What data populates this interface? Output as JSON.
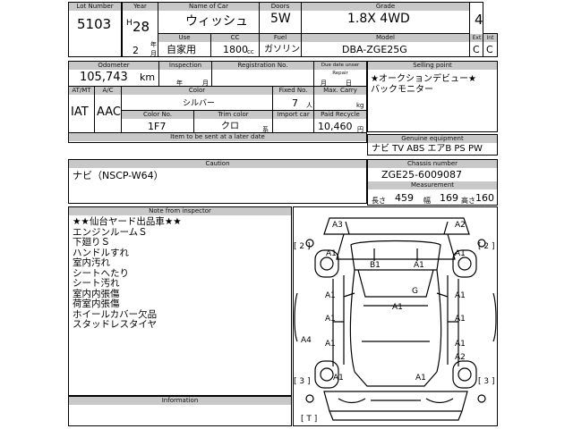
{
  "header": {
    "lot_number_label": "Lot Number",
    "lot_number": "5103",
    "year_label": "Year",
    "era": "H",
    "year": "28",
    "year_unit": "年",
    "month": "2",
    "month_unit": "月",
    "name_label": "Name of Car",
    "name": "ウィッシュ",
    "doors_label": "Doors",
    "doors": "5W",
    "grade_label": "Grade",
    "grade": "1.8X 4WD",
    "score": "4",
    "use_label": "Use",
    "use": "自家用",
    "cc_label": "CC",
    "cc": "1800",
    "cc_unit": "cc",
    "fuel_label": "Fuel",
    "fuel": "ガソリン",
    "model_label": "Model",
    "model": "DBA-ZGE25G",
    "ext_label": "Ext",
    "ext": "C",
    "int_label": "Int",
    "int": "C"
  },
  "row2": {
    "odometer_label": "Odometer",
    "odometer": "105,743",
    "odometer_unit": "km",
    "inspection_label": "Inspection",
    "inspection_year": "年",
    "inspection_month": "月",
    "registration_label": "Registration No.",
    "due_label": "Due date unser Repair",
    "due_month": "月",
    "due_day": "日",
    "selling_label": "Selling point",
    "selling_points": [
      "★オークションデビュー★",
      "バックモニター"
    ],
    "atmt_label": "AT/MT",
    "atmt": "IAT",
    "ac_label": "A/C",
    "ac": "AAC",
    "color_label": "Color",
    "color": "シルバー",
    "fixed_label": "Fixed No.",
    "fixed": "7",
    "fixed_unit": "人",
    "maxcarry_label": "Max. Carry",
    "maxcarry_unit": "kg",
    "colorno_label": "Color No.",
    "colorno": "1F7",
    "trim_label": "Trim color",
    "trim": "クロ",
    "trim_unit": "系",
    "import_label": "Import car",
    "recycle_label": "Paid Recycle",
    "recycle": "10,460",
    "recycle_unit": "円",
    "later_label": "Item to be sent at a later date",
    "equip_label": "Genuine equipment",
    "equipment": "ナビ TV ABS エアB PS PW"
  },
  "caution": {
    "label": "Caution",
    "text": "ナビ（NSCP-W64）"
  },
  "chassis": {
    "label": "Chassis number",
    "number": "ZGE25-6009087",
    "measure_label": "Measurement",
    "length_label": "長さ",
    "length": "459",
    "width_label": "幅",
    "width": "169",
    "height_label": "高さ",
    "height": "160"
  },
  "inspector": {
    "label": "Note from inspector",
    "notes": [
      "★★仙台ヤード出品車★★",
      "エンジンルームＳ",
      "下廻りＳ",
      "ハンドルすれ",
      "室内汚れ",
      "シートへたり",
      "シート汚れ",
      "室内内張傷",
      "荷室内張傷",
      "ホイールカバー欠品",
      "スタッドレスタイヤ"
    ]
  },
  "information": {
    "label": "Information"
  },
  "diagram": {
    "labels": {
      "a3": "A3",
      "a2_top": "A2",
      "a1_fl": "A1",
      "a1_fr": "A1",
      "b1": "B1",
      "a1_roof": "A1",
      "g": "G",
      "a1_ld1": "A1",
      "a1_rd1": "A1",
      "a1_ld2": "A1",
      "a1_rd2": "A1",
      "a1_center": "A1",
      "a4": "A4",
      "a2_rear": "A2",
      "a1_rl": "A1",
      "a1_rr": "A1",
      "a1_bl": "A1",
      "a1_bm": "A1"
    },
    "brackets": {
      "b2_left": "[ 2 ]",
      "b2_right": "[ 2 ]",
      "b3_left": "[ 3 ]",
      "b3_right": "[ 3 ]",
      "bt": "[ T ]"
    }
  }
}
